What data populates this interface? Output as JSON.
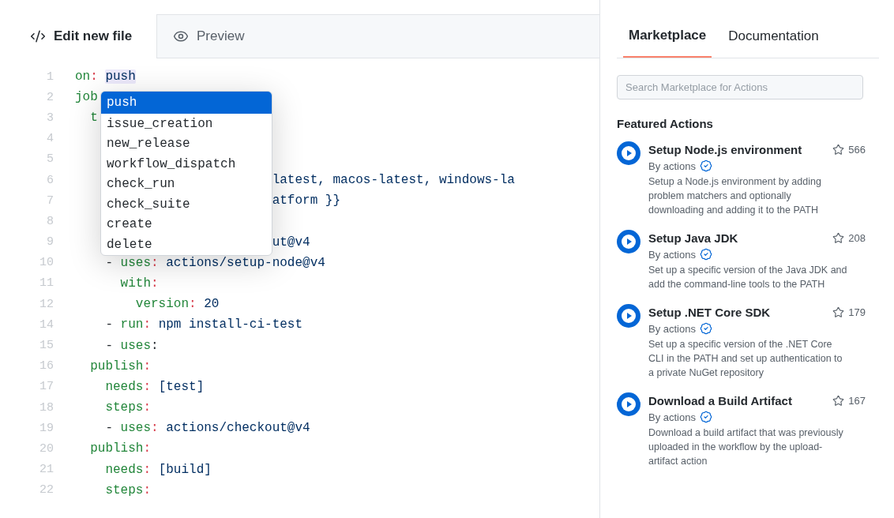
{
  "editor_tabs": [
    {
      "label": "Edit new file",
      "selected": true
    },
    {
      "label": "Preview",
      "selected": false
    }
  ],
  "code_lines": [
    {
      "number": "1",
      "segments": [
        {
          "kind": "key",
          "text": "on"
        },
        {
          "kind": "punct",
          "text": ": "
        },
        {
          "kind": "match",
          "text": "push"
        }
      ]
    },
    {
      "number": "2",
      "segments": [
        {
          "kind": "key",
          "text": "job"
        }
      ]
    },
    {
      "number": "3",
      "segments": [
        {
          "kind": "key",
          "text": "  t"
        }
      ]
    },
    {
      "number": "4"
    },
    {
      "number": "5"
    },
    {
      "number": "6",
      "segments": [
        {
          "kind": "value",
          "text": "                          latest, macos-latest, windows-la"
        }
      ]
    },
    {
      "number": "7",
      "segments": [
        {
          "kind": "value",
          "text": "                          atform }}"
        }
      ]
    },
    {
      "number": "8"
    },
    {
      "number": "9",
      "segments": [
        {
          "kind": "value",
          "text": "                          ut@v4"
        }
      ]
    },
    {
      "number": "10",
      "segments": [
        {
          "kind": "plain",
          "text": "    - "
        },
        {
          "kind": "key",
          "text": "uses"
        },
        {
          "kind": "punct",
          "text": ": "
        },
        {
          "kind": "value",
          "text": "actions/setup-node@v4"
        }
      ]
    },
    {
      "number": "11",
      "segments": [
        {
          "kind": "key",
          "text": "      with"
        },
        {
          "kind": "punct",
          "text": ":"
        }
      ]
    },
    {
      "number": "12",
      "segments": [
        {
          "kind": "key",
          "text": "        version"
        },
        {
          "kind": "punct",
          "text": ": "
        },
        {
          "kind": "value",
          "text": "20"
        }
      ]
    },
    {
      "number": "14",
      "segments": [
        {
          "kind": "plain",
          "text": "    - "
        },
        {
          "kind": "key",
          "text": "run"
        },
        {
          "kind": "punct",
          "text": ": "
        },
        {
          "kind": "value",
          "text": "npm install-ci-test"
        }
      ]
    },
    {
      "number": "15",
      "segments": [
        {
          "kind": "plain",
          "text": "    - "
        },
        {
          "kind": "key",
          "text": "uses"
        },
        {
          "kind": "plain",
          "text": ":"
        }
      ]
    },
    {
      "number": "16",
      "segments": [
        {
          "kind": "key",
          "text": "  publish"
        },
        {
          "kind": "punct",
          "text": ":"
        }
      ]
    },
    {
      "number": "17",
      "segments": [
        {
          "kind": "key",
          "text": "    needs"
        },
        {
          "kind": "punct",
          "text": ": "
        },
        {
          "kind": "value",
          "text": "[test]"
        }
      ]
    },
    {
      "number": "18",
      "segments": [
        {
          "kind": "key",
          "text": "    steps"
        },
        {
          "kind": "punct",
          "text": ":"
        }
      ]
    },
    {
      "number": "19",
      "segments": [
        {
          "kind": "plain",
          "text": "    - "
        },
        {
          "kind": "key",
          "text": "uses"
        },
        {
          "kind": "punct",
          "text": ": "
        },
        {
          "kind": "value",
          "text": "actions/checkout@v4"
        }
      ]
    },
    {
      "number": "20",
      "segments": [
        {
          "kind": "key",
          "text": "  publish"
        },
        {
          "kind": "punct",
          "text": ":"
        }
      ]
    },
    {
      "number": "21",
      "segments": [
        {
          "kind": "key",
          "text": "    needs"
        },
        {
          "kind": "punct",
          "text": ": "
        },
        {
          "kind": "value",
          "text": "[build]"
        }
      ]
    },
    {
      "number": "22",
      "segments": [
        {
          "kind": "key",
          "text": "    steps"
        },
        {
          "kind": "punct",
          "text": ":"
        }
      ]
    }
  ],
  "autocomplete": [
    {
      "label": "push",
      "selected": true
    },
    {
      "label": "issue_creation",
      "selected": false
    },
    {
      "label": "new_release",
      "selected": false
    },
    {
      "label": "workflow_dispatch",
      "selected": false
    },
    {
      "label": "check_run",
      "selected": false
    },
    {
      "label": "check_suite",
      "selected": false
    },
    {
      "label": "create",
      "selected": false
    },
    {
      "label": "delete",
      "selected": false
    }
  ],
  "sidebar": {
    "tabs": [
      {
        "label": "Marketplace",
        "selected": true
      },
      {
        "label": "Documentation",
        "selected": false
      }
    ],
    "search": {
      "placeholder": "Search Marketplace for Actions"
    },
    "heading": "Featured Actions",
    "actions": [
      {
        "title": "Setup Node.js environment",
        "stars": "566",
        "author": "By actions",
        "verified": true,
        "description": [
          "Setup a Node.js environment by adding",
          "problem matchers and optionally",
          "downloading and adding it to the PATH"
        ]
      },
      {
        "title": "Setup Java JDK",
        "stars": "208",
        "author": "By actions",
        "verified": true,
        "description": [
          "Set up a specific version of the Java JDK and",
          "add the command-line tools to the PATH"
        ]
      },
      {
        "title": "Setup .NET Core SDK",
        "stars": "179",
        "author": "By actions",
        "verified": true,
        "description": [
          "Set up a specific version of the .NET Core",
          "CLI in the PATH and set up authentication to",
          "a private NuGet repository"
        ]
      },
      {
        "title": "Download a Build Artifact",
        "stars": "167",
        "author": "By actions",
        "verified": true,
        "description": [
          "Download a build artifact that was previously",
          "uploaded in the workflow by the upload-",
          "artifact action"
        ]
      }
    ]
  }
}
